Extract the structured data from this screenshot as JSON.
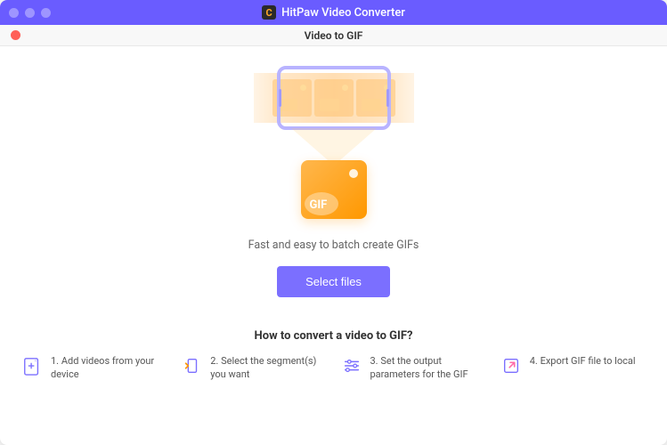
{
  "titlebar": {
    "app_name": "HitPaw Video Converter"
  },
  "subheader": {
    "title": "Video to GIF"
  },
  "main": {
    "gif_label": "GIF",
    "tagline": "Fast and easy to batch create GIFs",
    "select_button": "Select files"
  },
  "howto": {
    "title": "How to convert a video to GIF?",
    "steps": [
      {
        "num": "1.",
        "text": "Add videos from your device"
      },
      {
        "num": "2.",
        "text": "Select the segment(s) you want"
      },
      {
        "num": "3.",
        "text": "Set the output parameters for the GIF"
      },
      {
        "num": "4.",
        "text": "Export GIF file to local"
      }
    ]
  }
}
